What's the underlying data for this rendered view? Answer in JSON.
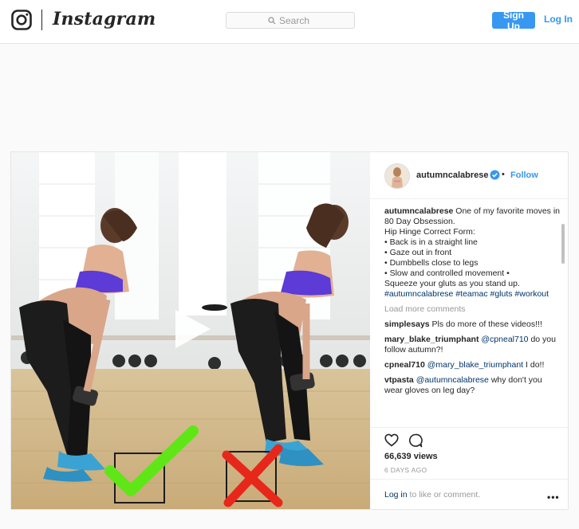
{
  "header": {
    "brand": "Instagram",
    "search_placeholder": "Search",
    "signup_label": "Sign Up",
    "login_label": "Log In"
  },
  "post": {
    "username": "autumncalabrese",
    "follow_label": "Follow",
    "dot": "•",
    "caption": {
      "username": "autumncalabrese",
      "text": "One of my favorite moves in 80 Day Obsession.",
      "lines": [
        "Hip Hinge Correct Form:",
        "• Back is in a straight line",
        "• Gaze out in front",
        "• Dumbbells close to legs",
        "• Slow and controlled movement •",
        "Squeeze your gluts as you stand up."
      ],
      "hashtags": "#autumncalabrese #teamac #gluts #workout"
    },
    "load_more": "Load more comments",
    "comments": [
      {
        "user": "simplesays",
        "mention": "",
        "text": "Pls do more of these videos!!!"
      },
      {
        "user": "mary_blake_triumphant",
        "mention": "@cpneal710",
        "text": "do you follow autumn?!"
      },
      {
        "user": "cpneal710",
        "mention": "@mary_blake_triumphant",
        "text": "I do!!"
      },
      {
        "user": "vtpasta",
        "mention": "@autumncalabrese",
        "text": "why don't you wear gloves on leg day?"
      }
    ],
    "views": "66,639 views",
    "time_ago": "6 DAYS AGO",
    "footer_login": "Log in",
    "footer_text": "to like or comment.",
    "more_label": "•••"
  },
  "colors": {
    "accent": "#3897f0",
    "link": "#003569",
    "check": "#5fe617",
    "cross": "#e8271b"
  }
}
